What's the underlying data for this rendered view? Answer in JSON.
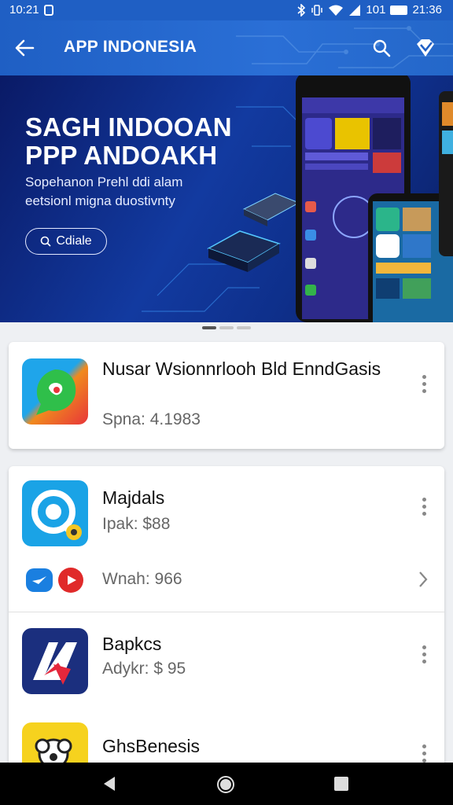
{
  "status_bar": {
    "time": "10:21",
    "right_text": "101",
    "clock": "21:36"
  },
  "app_bar": {
    "title": "APP INDONESIA",
    "back_icon": "back-arrow-icon",
    "search_icon": "search-icon",
    "extra_icon": "diamond-shield-icon"
  },
  "banner": {
    "headline": "SAGH INDOOAN\nPPP ANDOAKH",
    "subtitle": "Sopehanon Prehl ddi alam\neetsionl migna duostivnty",
    "cta_label": "Cdiale",
    "page_indicator": {
      "count": 3,
      "active": 0
    }
  },
  "apps": [
    {
      "name": "Nusar Wsionnrlooh Bld EnndGasis",
      "meta": "Spna: 4.1983",
      "icon": "green-whatsapp-like-icon"
    },
    {
      "name": "Majdals",
      "meta": "Ipak: $88",
      "icon": "circle-chat-icon",
      "sub_meta": "Wnah: 966",
      "sub_icons": [
        "twitter-bird-icon",
        "youtube-play-icon"
      ]
    },
    {
      "name": "Bapkcs",
      "meta": "Adykr: $ 95",
      "icon": "red-swoosh-icon"
    },
    {
      "name": "GhsBenesis",
      "meta": "",
      "icon": "yellow-flower-icon"
    }
  ],
  "colors": {
    "appbar": "#1f5fc4",
    "banner_dark": "#0a1a66",
    "card_bg": "#ffffff"
  }
}
